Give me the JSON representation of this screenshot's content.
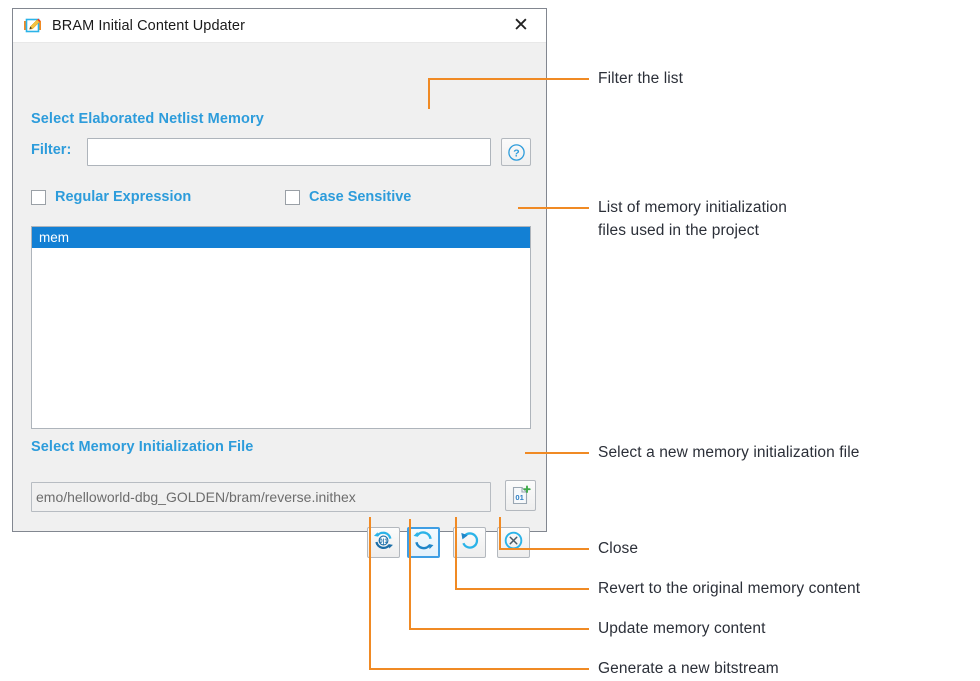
{
  "window": {
    "title": "BRAM Initial Content Updater",
    "icon": "bram-editor-icon",
    "close_icon": "close-icon",
    "close_label": "✕"
  },
  "sections": {
    "netlist_memory_label": "Select Elaborated Netlist Memory",
    "memory_init_file_label": "Select Memory Initialization File"
  },
  "filter": {
    "label": "Filter:",
    "value": "",
    "placeholder": "",
    "help_icon": "help-circle-icon",
    "help_glyph": "?"
  },
  "options": {
    "regular_expression": {
      "label": "Regular Expression",
      "checked": false
    },
    "case_sensitive": {
      "label": "Case Sensitive",
      "checked": false
    }
  },
  "memory_list": {
    "items": [
      {
        "label": "mem",
        "selected": true
      }
    ]
  },
  "memory_init_file": {
    "path": "emo/helloworld-dbg_GOLDEN/bram/reverse.inithex",
    "browse_icon": "new-file-01-icon",
    "browse_glyph": "01"
  },
  "actions": [
    {
      "name": "generate-bitstream-button",
      "icon": "refresh-bits-icon",
      "focused": false
    },
    {
      "name": "update-memory-button",
      "icon": "refresh-circular-icon",
      "focused": true
    },
    {
      "name": "revert-memory-button",
      "icon": "undo-arrow-icon",
      "focused": false
    },
    {
      "name": "close-dialog-button",
      "icon": "close-circle-icon",
      "focused": false
    }
  ],
  "annotations": [
    {
      "name": "annotation-filter",
      "text": "Filter the list"
    },
    {
      "name": "annotation-list-line1",
      "text": "List of memory initialization"
    },
    {
      "name": "annotation-list-line2",
      "text": "files used in the project"
    },
    {
      "name": "annotation-select-file",
      "text": "Select a new memory initialization file"
    },
    {
      "name": "annotation-close",
      "text": "Close"
    },
    {
      "name": "annotation-revert",
      "text": "Revert to the original memory content"
    },
    {
      "name": "annotation-update",
      "text": "Update memory content"
    },
    {
      "name": "annotation-bitstream",
      "text": "Generate a new bitstream"
    }
  ],
  "colors": {
    "accent_blue": "#2d9cdb",
    "selection_blue": "#1380d4",
    "leader_orange": "#f08a24",
    "annotation_text": "#2b2f38",
    "dialog_bg": "#f0f0f0"
  }
}
